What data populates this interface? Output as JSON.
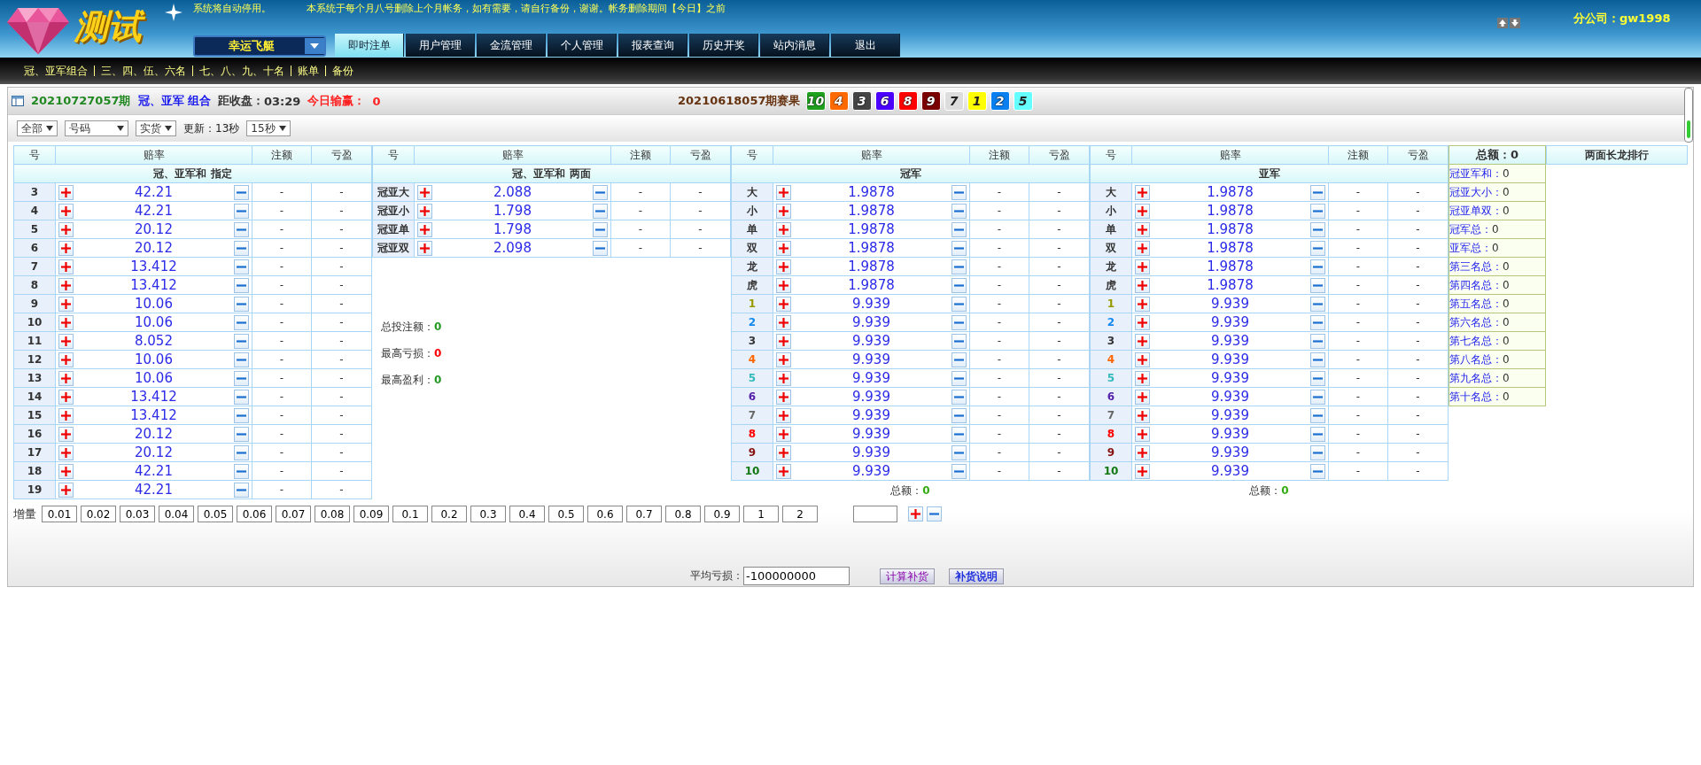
{
  "logo": {
    "text": "测试"
  },
  "notices": [
    "系统将自动停用。",
    "本系统于每个月八号删除上个月帐务，如有需要，请自行备份，谢谢。帐务删除期间【今日】之前"
  ],
  "game_select": {
    "value": "幸运飞艇"
  },
  "nav": [
    {
      "label": "即时注单",
      "selected": true
    },
    {
      "label": "用户管理",
      "selected": false
    },
    {
      "label": "金流管理",
      "selected": false
    },
    {
      "label": "个人管理",
      "selected": false
    },
    {
      "label": "报表查询",
      "selected": false
    },
    {
      "label": "历史开奖",
      "selected": false
    },
    {
      "label": "站内消息",
      "selected": false
    },
    {
      "label": "退出",
      "selected": false
    }
  ],
  "account": "分公司：gw1998",
  "subnav": [
    "冠、亚军组合",
    "三、四、伍、六名",
    "七、八、九、十名",
    "账单",
    "备份"
  ],
  "status": {
    "period": "20210727057期",
    "play": "冠、亚军 组合",
    "countdown_label": "距收盘：",
    "countdown": "03:29",
    "today_label": "今日输赢：",
    "today_value": "0",
    "result_label": "20210618057期赛果",
    "result_balls": [
      {
        "number": "10",
        "color": "#1fa01f"
      },
      {
        "number": "4",
        "color": "#ff6a00"
      },
      {
        "number": "3",
        "color": "#444444"
      },
      {
        "number": "6",
        "color": "#4b00ff"
      },
      {
        "number": "8",
        "color": "#ff0000"
      },
      {
        "number": "9",
        "color": "#7a0000"
      },
      {
        "number": "7",
        "color": "#dddddd"
      },
      {
        "number": "1",
        "color": "#ffff00"
      },
      {
        "number": "2",
        "color": "#0a7ff0"
      },
      {
        "number": "5",
        "color": "#66ffff"
      }
    ]
  },
  "filters": [
    "全部",
    "号码",
    "实货"
  ],
  "update_label": "更新：13秒",
  "interval": "15秒",
  "tables": [
    {
      "title": "冠、亚军和 指定",
      "columns": [
        "号",
        "赔率",
        "注额",
        "亏盈"
      ],
      "rows": [
        {
          "label": "3",
          "odds": "42.21",
          "amount": "-",
          "profit": "-"
        },
        {
          "label": "4",
          "odds": "42.21",
          "amount": "-",
          "profit": "-"
        },
        {
          "label": "5",
          "odds": "20.12",
          "amount": "-",
          "profit": "-"
        },
        {
          "label": "6",
          "odds": "20.12",
          "amount": "-",
          "profit": "-"
        },
        {
          "label": "7",
          "odds": "13.412",
          "amount": "-",
          "profit": "-"
        },
        {
          "label": "8",
          "odds": "13.412",
          "amount": "-",
          "profit": "-"
        },
        {
          "label": "9",
          "odds": "10.06",
          "amount": "-",
          "profit": "-"
        },
        {
          "label": "10",
          "odds": "10.06",
          "amount": "-",
          "profit": "-"
        },
        {
          "label": "11",
          "odds": "8.052",
          "amount": "-",
          "profit": "-"
        },
        {
          "label": "12",
          "odds": "10.06",
          "amount": "-",
          "profit": "-"
        },
        {
          "label": "13",
          "odds": "10.06",
          "amount": "-",
          "profit": "-"
        },
        {
          "label": "14",
          "odds": "13.412",
          "amount": "-",
          "profit": "-"
        },
        {
          "label": "15",
          "odds": "13.412",
          "amount": "-",
          "profit": "-"
        },
        {
          "label": "16",
          "odds": "20.12",
          "amount": "-",
          "profit": "-"
        },
        {
          "label": "17",
          "odds": "20.12",
          "amount": "-",
          "profit": "-"
        },
        {
          "label": "18",
          "odds": "42.21",
          "amount": "-",
          "profit": "-"
        },
        {
          "label": "19",
          "odds": "42.21",
          "amount": "-",
          "profit": "-"
        }
      ]
    },
    {
      "title": "冠、亚军和 两面",
      "columns": [
        "号",
        "赔率",
        "注额",
        "亏盈"
      ],
      "rows": [
        {
          "label": "冠亚大",
          "odds": "2.088",
          "amount": "-",
          "profit": "-"
        },
        {
          "label": "冠亚小",
          "odds": "1.798",
          "amount": "-",
          "profit": "-"
        },
        {
          "label": "冠亚单",
          "odds": "1.798",
          "amount": "-",
          "profit": "-"
        },
        {
          "label": "冠亚双",
          "odds": "2.098",
          "amount": "-",
          "profit": "-"
        }
      ],
      "stats": [
        {
          "label": "总投注额：",
          "value": "0",
          "color": "#229922"
        },
        {
          "label": "最高亏损：",
          "value": "0",
          "color": "#ff0000"
        },
        {
          "label": "最高盈利：",
          "value": "0",
          "color": "#229922"
        }
      ]
    },
    {
      "title": "冠军",
      "columns": [
        "号",
        "赔率",
        "注额",
        "亏盈"
      ],
      "rows": [
        {
          "label": "大",
          "odds": "1.9878",
          "amount": "-",
          "profit": "-"
        },
        {
          "label": "小",
          "odds": "1.9878",
          "amount": "-",
          "profit": "-"
        },
        {
          "label": "单",
          "odds": "1.9878",
          "amount": "-",
          "profit": "-"
        },
        {
          "label": "双",
          "odds": "1.9878",
          "amount": "-",
          "profit": "-"
        },
        {
          "label": "龙",
          "odds": "1.9878",
          "amount": "-",
          "profit": "-"
        },
        {
          "label": "虎",
          "odds": "1.9878",
          "amount": "-",
          "profit": "-"
        },
        {
          "label": "1",
          "odds": "9.939",
          "amount": "-",
          "profit": "-",
          "color": "#999900"
        },
        {
          "label": "2",
          "odds": "9.939",
          "amount": "-",
          "profit": "-",
          "color": "#1188ee"
        },
        {
          "label": "3",
          "odds": "9.939",
          "amount": "-",
          "profit": "-",
          "color": "#333333"
        },
        {
          "label": "4",
          "odds": "9.939",
          "amount": "-",
          "profit": "-",
          "color": "#ff6600"
        },
        {
          "label": "5",
          "odds": "9.939",
          "amount": "-",
          "profit": "-",
          "color": "#33bbbb"
        },
        {
          "label": "6",
          "odds": "9.939",
          "amount": "-",
          "profit": "-",
          "color": "#5522aa"
        },
        {
          "label": "7",
          "odds": "9.939",
          "amount": "-",
          "profit": "-",
          "color": "#666666"
        },
        {
          "label": "8",
          "odds": "9.939",
          "amount": "-",
          "profit": "-",
          "color": "#ff0000"
        },
        {
          "label": "9",
          "odds": "9.939",
          "amount": "-",
          "profit": "-",
          "color": "#881111"
        },
        {
          "label": "10",
          "odds": "9.939",
          "amount": "-",
          "profit": "-",
          "color": "#117711"
        }
      ],
      "total": {
        "label": "总额：",
        "value": "0"
      }
    },
    {
      "title": "亚军",
      "columns": [
        "号",
        "赔率",
        "注额",
        "亏盈"
      ],
      "rows": [
        {
          "label": "大",
          "odds": "1.9878",
          "amount": "-",
          "profit": "-"
        },
        {
          "label": "小",
          "odds": "1.9878",
          "amount": "-",
          "profit": "-"
        },
        {
          "label": "单",
          "odds": "1.9878",
          "amount": "-",
          "profit": "-"
        },
        {
          "label": "双",
          "odds": "1.9878",
          "amount": "-",
          "profit": "-"
        },
        {
          "label": "龙",
          "odds": "1.9878",
          "amount": "-",
          "profit": "-"
        },
        {
          "label": "虎",
          "odds": "1.9878",
          "amount": "-",
          "profit": "-"
        },
        {
          "label": "1",
          "odds": "9.939",
          "amount": "-",
          "profit": "-",
          "color": "#999900"
        },
        {
          "label": "2",
          "odds": "9.939",
          "amount": "-",
          "profit": "-",
          "color": "#1188ee"
        },
        {
          "label": "3",
          "odds": "9.939",
          "amount": "-",
          "profit": "-",
          "color": "#333333"
        },
        {
          "label": "4",
          "odds": "9.939",
          "amount": "-",
          "profit": "-",
          "color": "#ff6600"
        },
        {
          "label": "5",
          "odds": "9.939",
          "amount": "-",
          "profit": "-",
          "color": "#33bbbb"
        },
        {
          "label": "6",
          "odds": "9.939",
          "amount": "-",
          "profit": "-",
          "color": "#5522aa"
        },
        {
          "label": "7",
          "odds": "9.939",
          "amount": "-",
          "profit": "-",
          "color": "#666666"
        },
        {
          "label": "8",
          "odds": "9.939",
          "amount": "-",
          "profit": "-",
          "color": "#ff0000"
        },
        {
          "label": "9",
          "odds": "9.939",
          "amount": "-",
          "profit": "-",
          "color": "#881111"
        },
        {
          "label": "10",
          "odds": "9.939",
          "amount": "-",
          "profit": "-",
          "color": "#117711"
        }
      ],
      "total": {
        "label": "总额：",
        "value": "0"
      }
    }
  ],
  "summary": {
    "header": "总额：0",
    "items": [
      {
        "label": "冠亚军和：",
        "value": "0"
      },
      {
        "label": "冠亚大小：",
        "value": "0"
      },
      {
        "label": "冠亚单双：",
        "value": "0"
      },
      {
        "label": "冠军总：",
        "value": "0"
      },
      {
        "label": "亚军总：",
        "value": "0"
      },
      {
        "label": "第三名总：",
        "value": "0"
      },
      {
        "label": "第四名总：",
        "value": "0"
      },
      {
        "label": "第五名总：",
        "value": "0"
      },
      {
        "label": "第六名总：",
        "value": "0"
      },
      {
        "label": "第七名总：",
        "value": "0"
      },
      {
        "label": "第八名总：",
        "value": "0"
      },
      {
        "label": "第九名总：",
        "value": "0"
      },
      {
        "label": "第十名总：",
        "value": "0"
      }
    ]
  },
  "dragon_header": "两面长龙排行",
  "increment_label": "增量",
  "increments": [
    "0.01",
    "0.02",
    "0.03",
    "0.04",
    "0.05",
    "0.06",
    "0.07",
    "0.08",
    "0.09",
    "0.1",
    "0.2",
    "0.3",
    "0.4",
    "0.5",
    "0.6",
    "0.7",
    "0.8",
    "0.9",
    "1",
    "2"
  ],
  "avg_loss": {
    "label": "平均亏损：",
    "value": "-100000000"
  },
  "buttons": [
    "计算补货",
    "补货说明"
  ]
}
